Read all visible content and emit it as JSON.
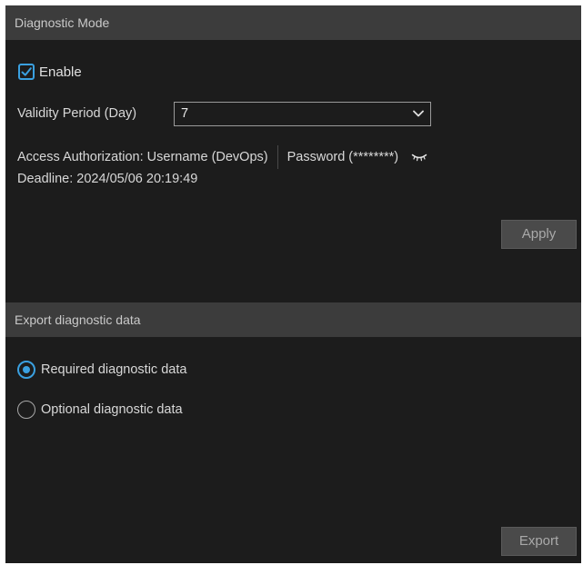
{
  "diagnostic_mode": {
    "title": "Diagnostic Mode",
    "enable_label": "Enable",
    "enable_checked": true,
    "validity_label": "Validity Period (Day)",
    "validity_value": "7",
    "access_authorization": "Access Authorization: Username (DevOps)",
    "password": "Password (********)",
    "deadline": "Deadline: 2024/05/06 20:19:49",
    "apply_label": "Apply"
  },
  "export": {
    "title": "Export diagnostic data",
    "options": [
      {
        "label": "Required diagnostic data",
        "selected": true
      },
      {
        "label": "Optional diagnostic data",
        "selected": false
      }
    ],
    "export_label": "Export"
  },
  "colors": {
    "accent": "#3aa0e0",
    "background": "#1c1c1c",
    "header": "#3c3c3c",
    "button": "#4a4a4a"
  },
  "icons": {
    "checkbox": "check-icon",
    "select": "chevron-down-icon",
    "password_toggle": "eye-closed-icon"
  }
}
